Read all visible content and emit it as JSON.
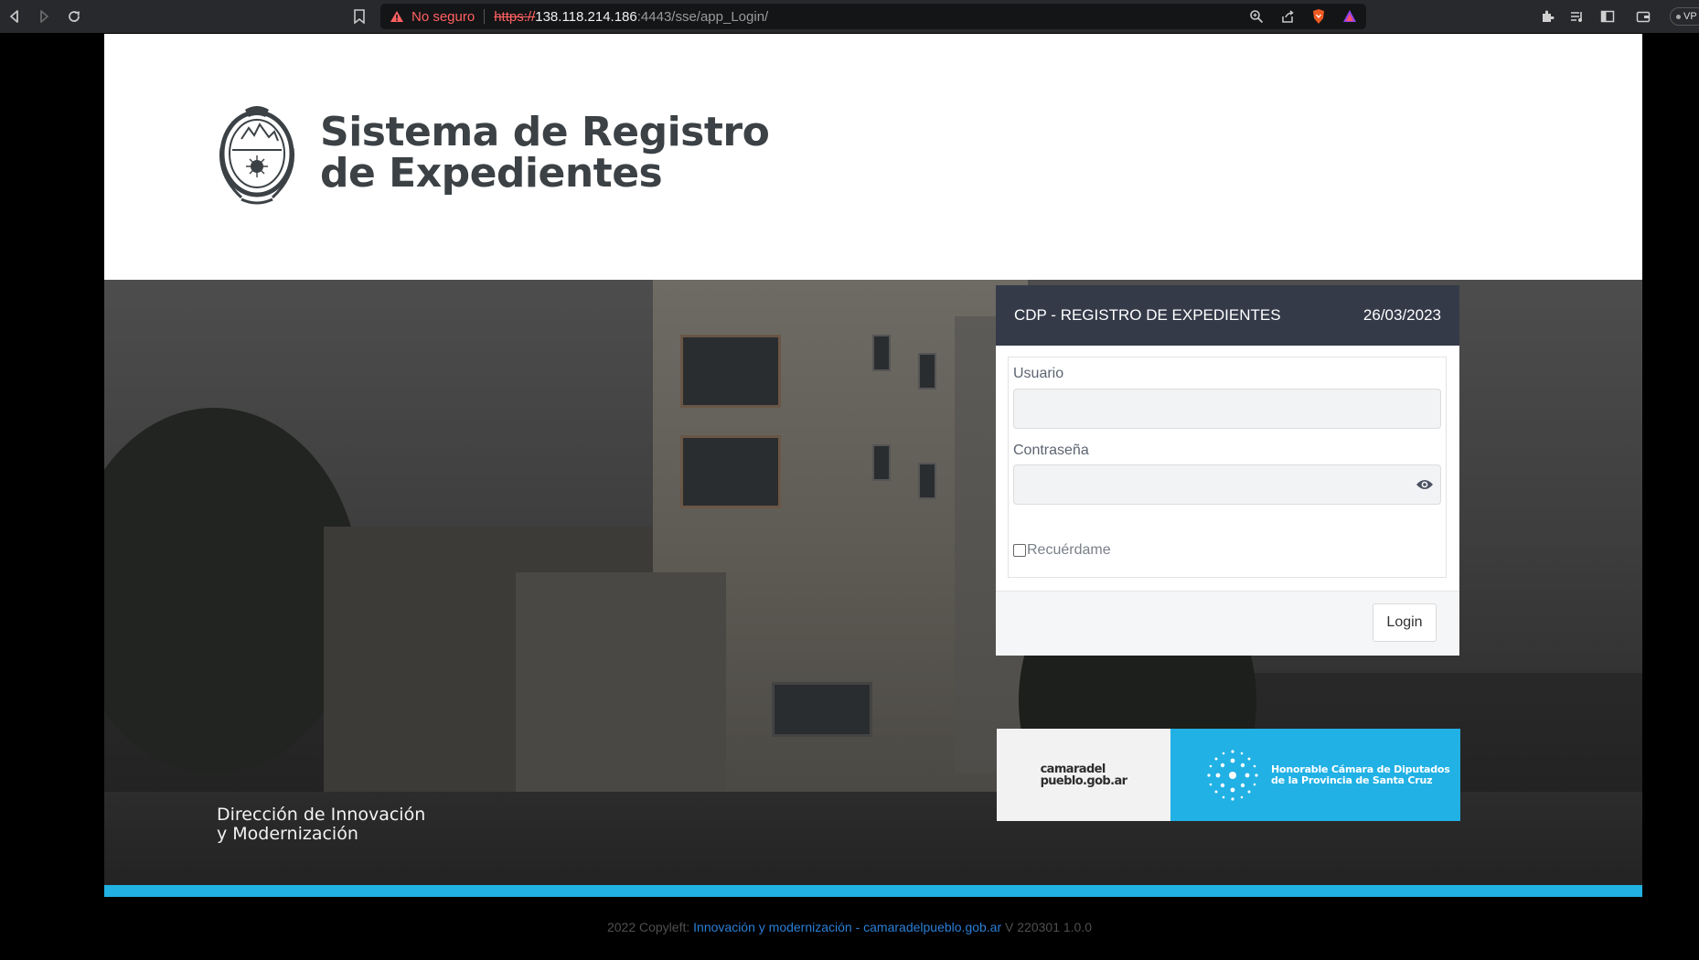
{
  "browser": {
    "security_label": "No seguro",
    "url_protocol": "https://",
    "url_host": "138.118.214.186",
    "url_rest": ":4443/sse/app_Login/",
    "vpn_label": "VP"
  },
  "header": {
    "title_line1": "Sistema de Registro",
    "title_line2": "de Expedientes"
  },
  "hero": {
    "direction_line1": "Dirección de Innovación",
    "direction_line2": "y Modernización"
  },
  "login": {
    "title": "CDP - REGISTRO DE EXPEDIENTES",
    "date": "26/03/2023",
    "username_label": "Usuario",
    "username_value": "",
    "password_label": "Contraseña",
    "password_value": "",
    "remember_label": "Recuérdame",
    "submit_label": "Login"
  },
  "banner": {
    "site_line1": "camaradel",
    "site_line2": "pueblo.gob.ar",
    "institution_line1": "Honorable Cámara de Diputados",
    "institution_line2": "de la Provincia de Santa Cruz"
  },
  "footer": {
    "prefix": "2022 Copyleft",
    "link_text": "Innovación y modernización - camaradelpueblo.gob.ar",
    "version": "V 220301 1.0.0"
  },
  "colors": {
    "header_bar": "#343a48",
    "accent_blue": "#22b1e3",
    "footer_link": "#2a7fd6",
    "title_text": "#3b4145"
  }
}
